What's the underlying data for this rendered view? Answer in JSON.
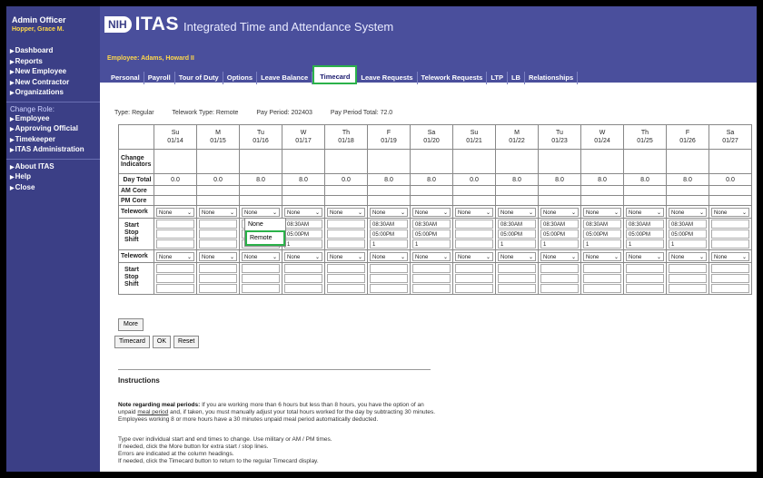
{
  "header": {
    "user_role": "Admin Officer",
    "user_name": "Hopper, Grace M.",
    "logo_nih": "NIH",
    "logo_itas": "ITAS",
    "system_title": "Integrated Time and Attendance System"
  },
  "sidebar": {
    "nav": [
      "Dashboard",
      "Reports",
      "New Employee",
      "New Contractor",
      "Organizations"
    ],
    "change_role_label": "Change Role:",
    "roles": [
      "Employee",
      "Approving Official",
      "Timekeeper",
      "ITAS Administration"
    ],
    "misc": [
      "About ITAS",
      "Help",
      "Close"
    ]
  },
  "employee_label": "Employee: Adams, Howard II",
  "tabs": [
    "Personal",
    "Payroll",
    "Tour of Duty",
    "Options",
    "Leave Balance",
    "Timecard",
    "Leave Requests",
    "Telework Requests",
    "LTP",
    "LB",
    "Relationships"
  ],
  "active_tab": "Timecard",
  "typeline": {
    "type": "Type: Regular",
    "telework": "Telework Type: Remote",
    "pay_period": "Pay Period: 202403",
    "total": "Pay Period Total: 72.0"
  },
  "days": [
    {
      "dow": "Su",
      "date": "01/14"
    },
    {
      "dow": "M",
      "date": "01/15"
    },
    {
      "dow": "Tu",
      "date": "01/16"
    },
    {
      "dow": "W",
      "date": "01/17"
    },
    {
      "dow": "Th",
      "date": "01/18"
    },
    {
      "dow": "F",
      "date": "01/19"
    },
    {
      "dow": "Sa",
      "date": "01/20"
    },
    {
      "dow": "Su",
      "date": "01/21"
    },
    {
      "dow": "M",
      "date": "01/22"
    },
    {
      "dow": "Tu",
      "date": "01/23"
    },
    {
      "dow": "W",
      "date": "01/24"
    },
    {
      "dow": "Th",
      "date": "01/25"
    },
    {
      "dow": "F",
      "date": "01/26"
    },
    {
      "dow": "Sa",
      "date": "01/27"
    }
  ],
  "row_labels": {
    "change": "Change Indicators",
    "total": "Day Total",
    "am": "AM Core",
    "pm": "PM Core",
    "telework": "Telework",
    "start": "Start",
    "stop": "Stop",
    "shift": "Shift"
  },
  "day_totals": [
    "0.0",
    "0.0",
    "8.0",
    "8.0",
    "0.0",
    "8.0",
    "8.0",
    "0.0",
    "8.0",
    "8.0",
    "8.0",
    "8.0",
    "8.0",
    "0.0"
  ],
  "telework_values": [
    "None",
    "None",
    "None",
    "None",
    "None",
    "None",
    "None",
    "None",
    "None",
    "None",
    "None",
    "None",
    "None",
    "None"
  ],
  "shift1": [
    {
      "start": "",
      "stop": "",
      "shift": ""
    },
    {
      "start": "",
      "stop": "",
      "shift": ""
    },
    {
      "start": "",
      "stop": "",
      "shift": ""
    },
    {
      "start": "08:30AM",
      "stop": "05:00PM",
      "shift": "1"
    },
    {
      "start": "",
      "stop": "",
      "shift": ""
    },
    {
      "start": "08:30AM",
      "stop": "05:00PM",
      "shift": "1"
    },
    {
      "start": "08:30AM",
      "stop": "05:00PM",
      "shift": "1"
    },
    {
      "start": "",
      "stop": "",
      "shift": ""
    },
    {
      "start": "08:30AM",
      "stop": "05:00PM",
      "shift": "1"
    },
    {
      "start": "08:30AM",
      "stop": "05:00PM",
      "shift": "1"
    },
    {
      "start": "08:30AM",
      "stop": "05:00PM",
      "shift": "1"
    },
    {
      "start": "08:30AM",
      "stop": "05:00PM",
      "shift": "1"
    },
    {
      "start": "08:30AM",
      "stop": "05:00PM",
      "shift": "1"
    },
    {
      "start": "",
      "stop": "",
      "shift": ""
    }
  ],
  "dropdown_options": [
    "None",
    "Remote"
  ],
  "dropdown_highlight": "Remote",
  "buttons": {
    "more": "More",
    "timecard": "Timecard",
    "ok": "OK",
    "reset": "Reset"
  },
  "instructions": {
    "title": "Instructions",
    "note_bold": "Note regarding meal periods:",
    "note_text1": " If you are working more than 6 hours but less than 8 hours, you have the option of an unpaid ",
    "note_link": "meal period",
    "note_text2": " and, if taken, you must manually adjust your total hours worked for the day by subtracting 30 minutes. Employees working 8 or more hours have a 30 minutes unpaid meal period automatically deducted.",
    "lines": [
      "Type over individual start and end times to change. Use military or AM / PM times.",
      "If needed, click the More button for extra start / stop lines.",
      "Errors are indicated at the column headings.",
      "If needed, click the Timecard button to return to the regular Timecard display."
    ]
  },
  "colors": {
    "header_bg": "#4a4f9c",
    "sidebar_bg": "#3b3f86",
    "highlight": "#2bb24a",
    "accent_yellow": "#ffd84a"
  }
}
